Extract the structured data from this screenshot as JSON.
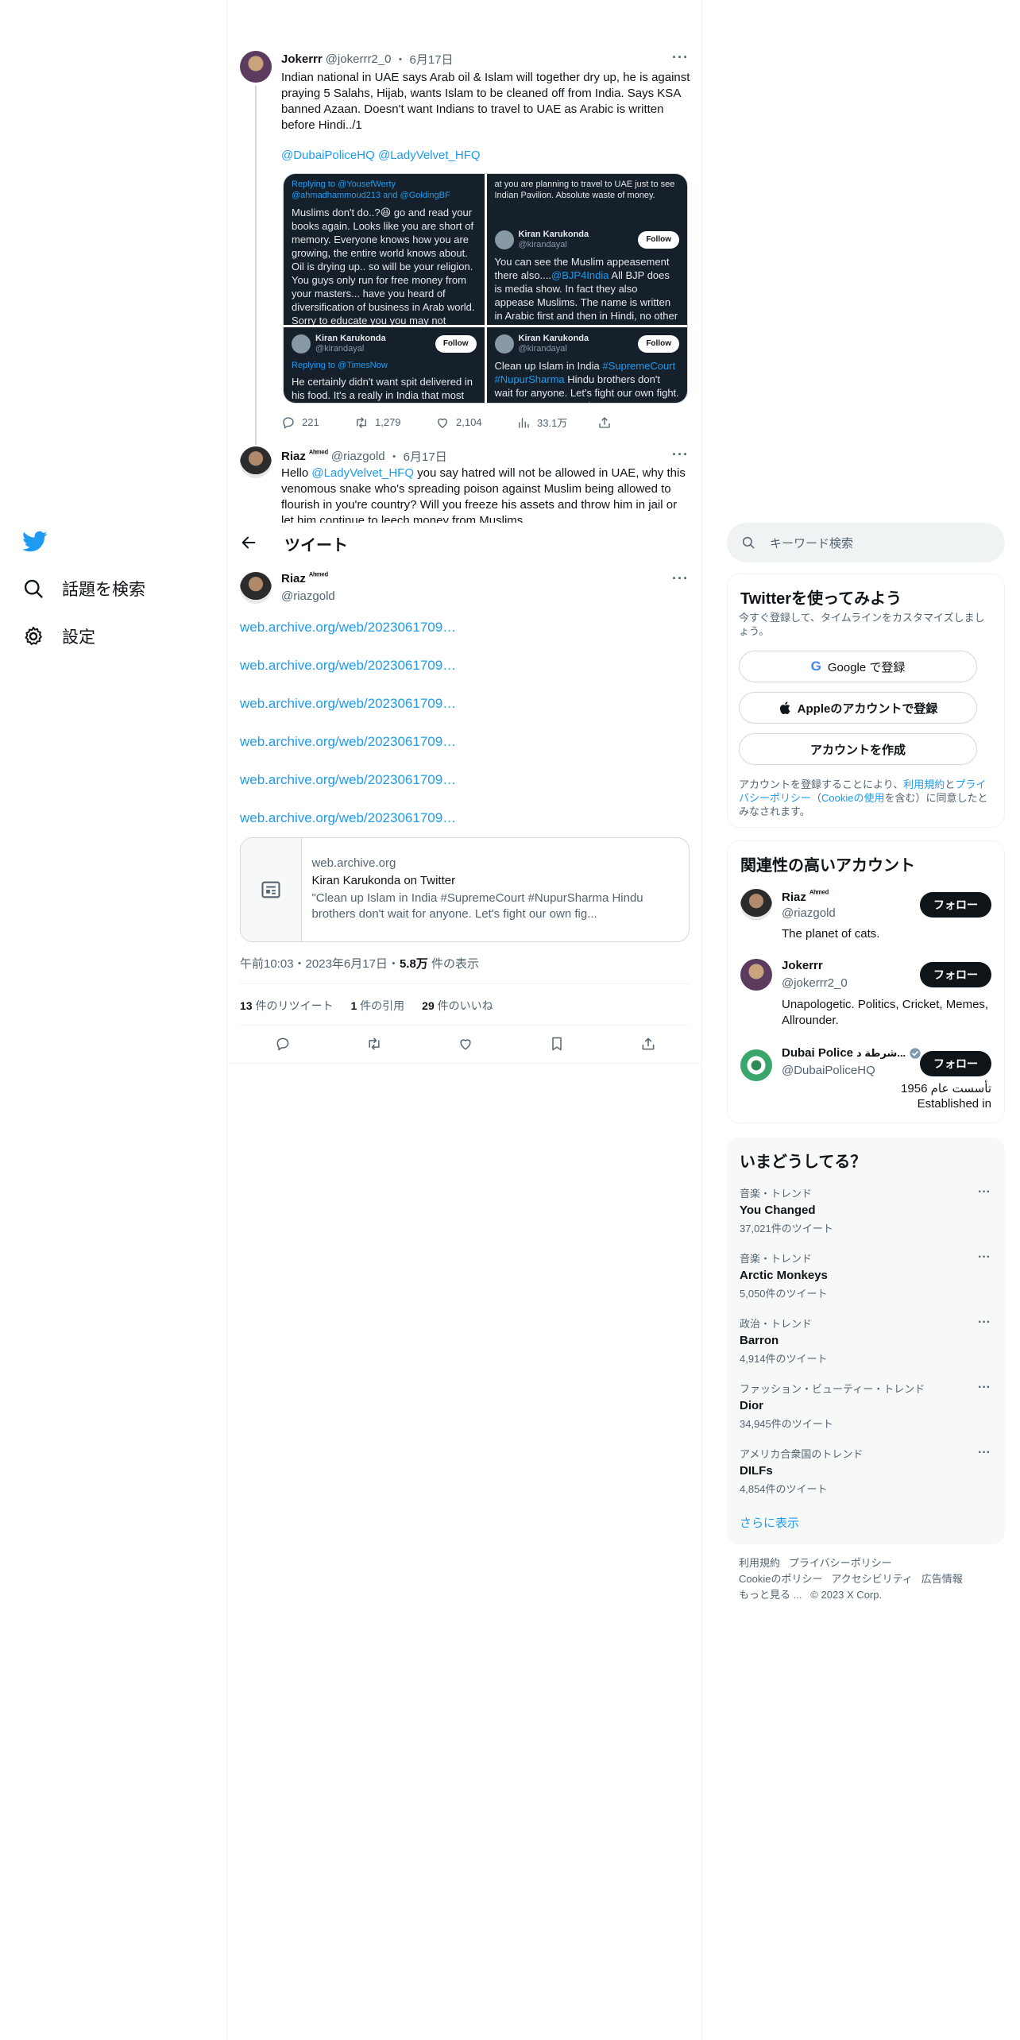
{
  "nav": {
    "explore": "話題を検索",
    "settings": "設定"
  },
  "thread": {
    "tweet1": {
      "name": "Jokerrr",
      "handle": "@jokerrr2_0",
      "date": "6月17日",
      "text": "Indian national in UAE says Arab oil & Islam will together dry up, he is against praying 5 Salahs, Hijab, wants Islam to be cleaned off from India. Says KSA banned Azaan. Doesn't want Indians to travel to UAE as Arabic is written before Hindi../1",
      "mention1": "@DubaiPoliceHQ",
      "mention2": "@LadyVelvet_HFQ",
      "replies": "221",
      "retweets": "1,279",
      "likes": "2,104",
      "views": "33.1万"
    },
    "media": {
      "s1_reply": "Replying to @YousefWerty @ahmadhammoud213 and @GoldingBF",
      "s1_text": "Muslims don't do..?😆 go and read your books again. Looks like you are short of memory. Everyone knows how you are growing, the entire world knows about. Oil is drying up.. so will be your religion. You guys only run for free money from your masters... have you heard of diversification of business in Arab world. Sorry to educate you you may not understand. Dream of hoors suits you right.",
      "s2_top": "at you are planning to travel to UAE just to see Indian Pavilion. Absolute waste of money.",
      "s2_name": "Kiran Karukonda",
      "s2_handle": "@kirandayal",
      "s2_pre": "You can see the Muslim appeasement there also....",
      "s2_tag": "@BJP4India",
      "s2_post": " All BJP does is media show. In fact they also appease Muslims. The name is written in Arabic first and then in Hindi, no other country has done it. Only and only India has done it. Shame! Shame!",
      "s3_name": "Kiran Karukonda",
      "s3_handle": "@kirandayal",
      "s3_reply": "Replying to @TimesNow",
      "s3_text": "He certainly didn't want spit delivered in his food. It's a really in India that most Muslim delivery boys spit on food. The packing is",
      "s4_name": "Kiran Karukonda",
      "s4_handle": "@kirandayal",
      "s4_pre": "Clean up Islam in India ",
      "s4_tag1": "#SupremeCourt",
      "s4_tag2": "#NupurSharma",
      "s4_post": " Hindu brothers don't wait for anyone. Let's fight our own fight. Come on streets and protest. Last chance for us.",
      "follow": "Follow"
    },
    "tweet2": {
      "name": "Riaz",
      "name_sup": "ᴬʰᵐᵉᵈ",
      "handle": "@riazgold",
      "date": "6月17日",
      "text_pre": "Hello ",
      "mention": "@LadyVelvet_HFQ",
      "text_post": " you say hatred will not be allowed in UAE, why this venomous snake who's spreading poison against Muslim being allowed to flourish in you're country? Will you freeze his assets and throw him in jail or let him continue to leech money from Muslims"
    }
  },
  "header": {
    "title": "ツイート"
  },
  "main_tweet": {
    "name": "Riaz",
    "name_sup": "ᴬʰᵐᵉᵈ",
    "handle": "@riazgold",
    "links": [
      "web.archive.org/web/2023061709…",
      "web.archive.org/web/2023061709…",
      "web.archive.org/web/2023061709…",
      "web.archive.org/web/2023061709…",
      "web.archive.org/web/2023061709…",
      "web.archive.org/web/2023061709…"
    ],
    "card": {
      "domain": "web.archive.org",
      "title": "Kiran Karukonda on Twitter",
      "desc": "\"Clean up Islam in India #SupremeCourt #NupurSharma Hindu brothers don't wait for anyone. Let's fight our own fig..."
    },
    "timestamp": "午前10:03・2023年6月17日・",
    "views_num": "5.8万",
    "views_label": " 件の表示",
    "retweets_num": "13",
    "retweets_label": " 件のリツイート",
    "quotes_num": "1",
    "quotes_label": " 件の引用",
    "likes_num": "29",
    "likes_label": " 件のいいね"
  },
  "sidebar": {
    "search_placeholder": "キーワード検索",
    "signup": {
      "title": "Twitterを使ってみよう",
      "subtitle": "今すぐ登録して、タイムラインをカスタマイズしましょう。",
      "google": "Google で登録",
      "apple": "Appleのアカウントで登録",
      "create": "アカウントを作成",
      "legal_1": "アカウントを登録することにより、",
      "legal_terms": "利用規約",
      "legal_2": "と",
      "legal_privacy": "プライバシーポリシー",
      "legal_3": "（",
      "legal_cookie": "Cookieの使用",
      "legal_4": "を含む）に同意したとみなされます。"
    },
    "relevant": {
      "title": "関連性の高いアカウント",
      "follow_label": "フォロー",
      "accounts": [
        {
          "name": "Riaz",
          "sup": "ᴬʰᵐᵉᵈ",
          "handle": "@riazgold",
          "bio": "The planet of cats."
        },
        {
          "name": "Jokerrr",
          "sup": "",
          "handle": "@jokerrr2_0",
          "bio": "Unapologetic. Politics, Cricket, Memes, Allrounder."
        },
        {
          "name": "Dubai Police",
          "sup": "شرطة د...",
          "handle": "@DubaiPoliceHQ",
          "bio_ar": "تأسست عام 1956",
          "bio": "Established in"
        }
      ]
    },
    "trends": {
      "title": "いまどうしてる？",
      "items": [
        {
          "meta": "音楽・トレンド",
          "name": "You Changed",
          "count": "37,021件のツイート"
        },
        {
          "meta": "音楽・トレンド",
          "name": "Arctic Monkeys",
          "count": "5,050件のツイート"
        },
        {
          "meta": "政治・トレンド",
          "name": "Barron",
          "count": "4,914件のツイート"
        },
        {
          "meta": "ファッション・ビューティー・トレンド",
          "name": "Dior",
          "count": "34,945件のツイート"
        },
        {
          "meta": "アメリカ合衆国のトレンド",
          "name": "DILFs",
          "count": "4,854件のツイート"
        }
      ],
      "show_more": "さらに表示"
    },
    "footer": {
      "l1a": "利用規約",
      "l1b": "プライバシーポリシー",
      "l2a": "Cookieのポリシー",
      "l2b": "アクセシビリティ",
      "l2c": "広告情報",
      "l3a": "もっと見る ...",
      "l3b": "© 2023 X Corp."
    }
  },
  "colors": {
    "accent": "#1d9bf0",
    "text": "#0f1419",
    "muted": "#536471"
  }
}
